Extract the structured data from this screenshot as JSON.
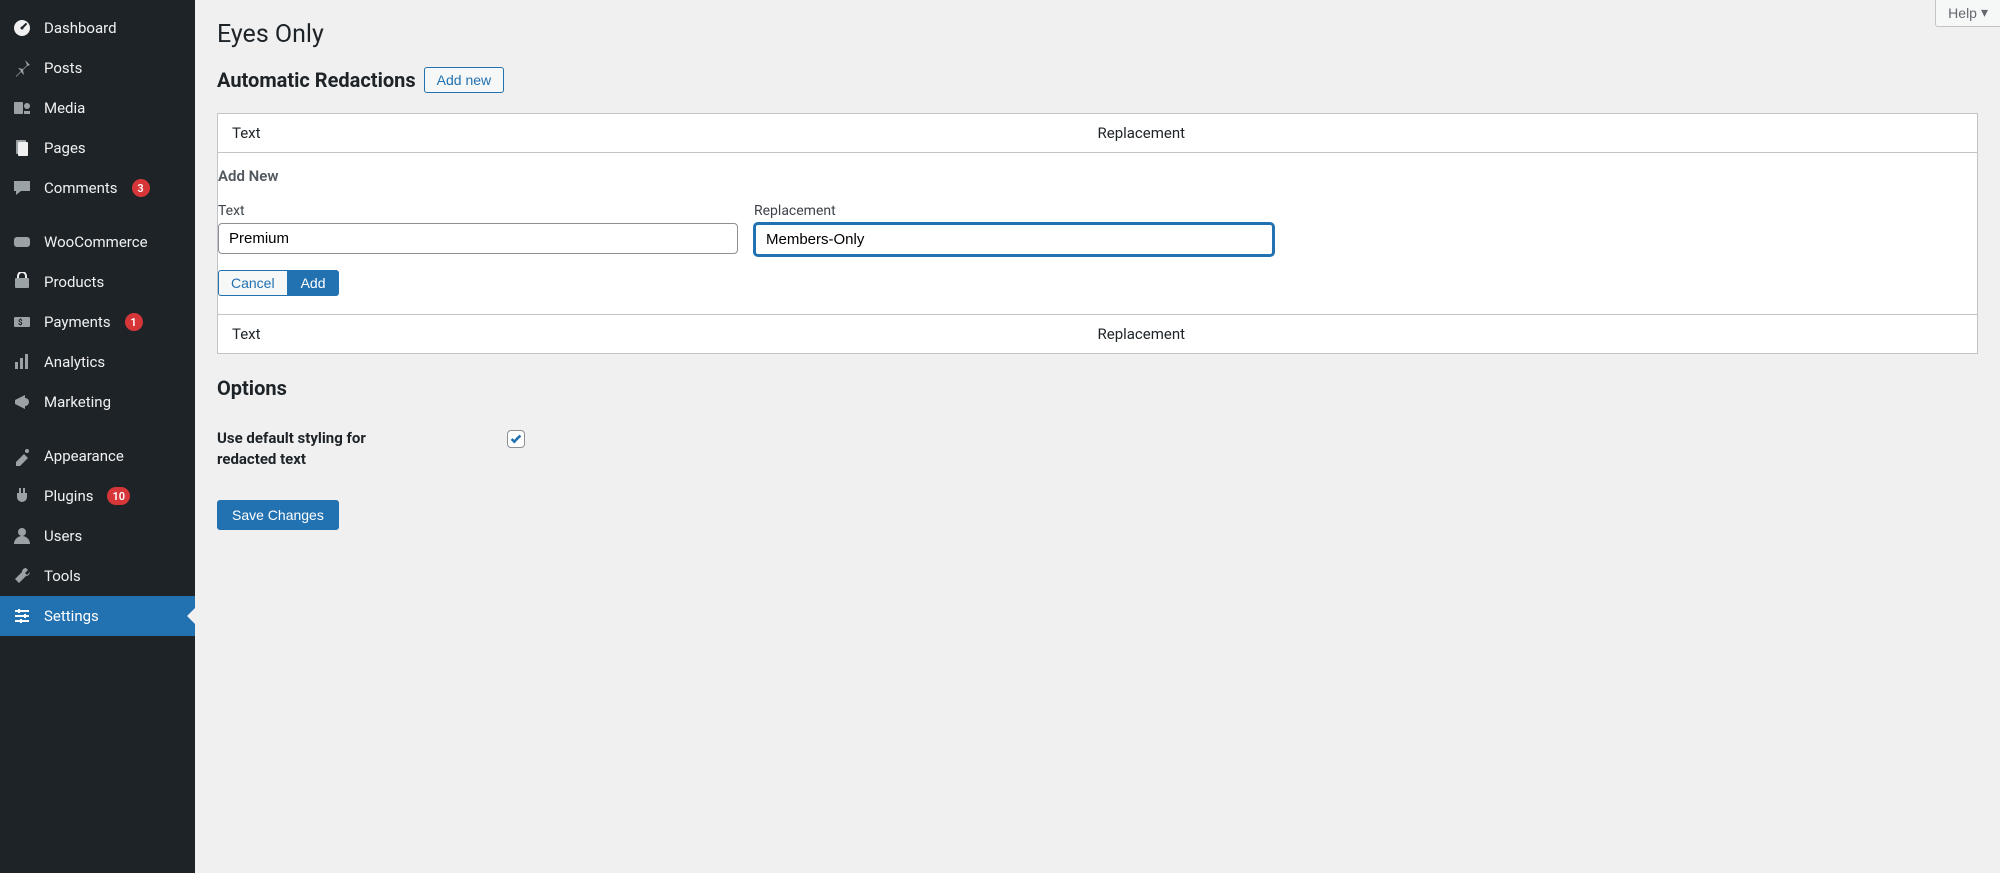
{
  "help_label": "Help",
  "page_title": "Eyes Only",
  "section_heading": "Automatic Redactions",
  "add_new_btn": "Add new",
  "table": {
    "col_text": "Text",
    "col_replacement": "Replacement"
  },
  "add_form": {
    "title": "Add New",
    "text_label": "Text",
    "text_value": "Premium",
    "replacement_label": "Replacement",
    "replacement_value": "Members-Only",
    "cancel": "Cancel",
    "add": "Add"
  },
  "options_heading": "Options",
  "option_default_styling_label": "Use default styling for redacted text",
  "option_default_styling_checked": true,
  "save_changes": "Save Changes",
  "sidebar": {
    "items": [
      {
        "label": "Dashboard",
        "icon": "dashboard"
      },
      {
        "label": "Posts",
        "icon": "pin"
      },
      {
        "label": "Media",
        "icon": "media"
      },
      {
        "label": "Pages",
        "icon": "pages"
      },
      {
        "label": "Comments",
        "icon": "comments",
        "badge": "3"
      },
      {
        "sep": true
      },
      {
        "label": "WooCommerce",
        "icon": "woo"
      },
      {
        "label": "Products",
        "icon": "products"
      },
      {
        "label": "Payments",
        "icon": "payments",
        "badge": "1"
      },
      {
        "label": "Analytics",
        "icon": "analytics"
      },
      {
        "label": "Marketing",
        "icon": "marketing"
      },
      {
        "sep": true
      },
      {
        "label": "Appearance",
        "icon": "appearance"
      },
      {
        "label": "Plugins",
        "icon": "plugins",
        "badge": "10"
      },
      {
        "label": "Users",
        "icon": "users"
      },
      {
        "label": "Tools",
        "icon": "tools"
      },
      {
        "label": "Settings",
        "icon": "settings",
        "active": true
      }
    ]
  }
}
